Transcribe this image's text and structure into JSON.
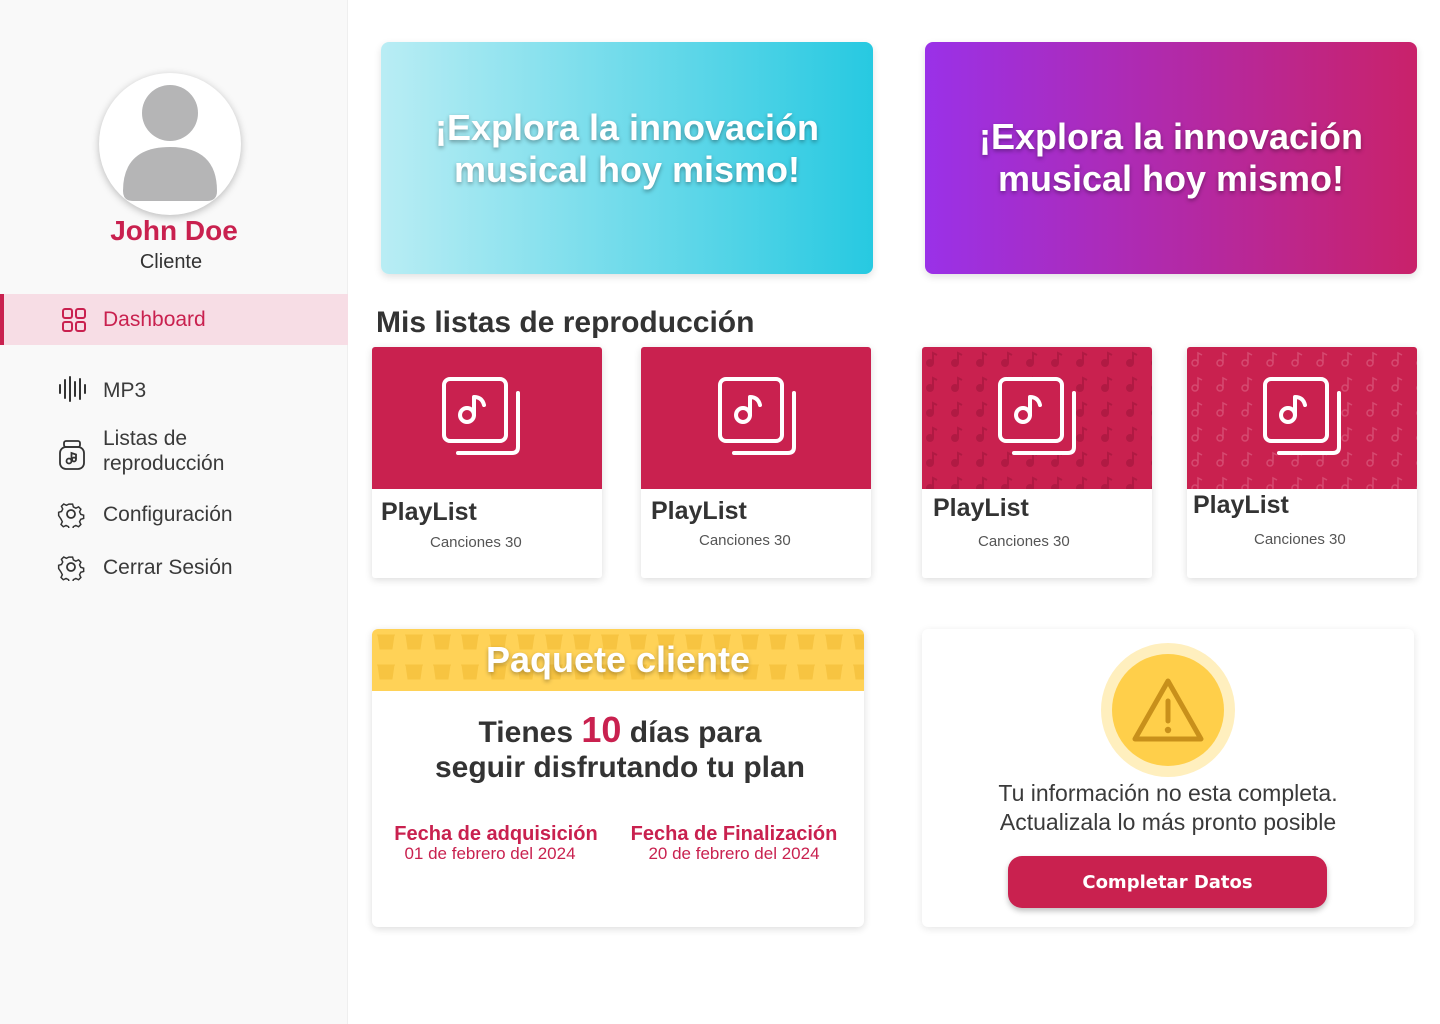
{
  "user": {
    "name": "John Doe",
    "role": "Cliente"
  },
  "sidebar": {
    "items": [
      {
        "label": "Dashboard",
        "icon": "grid-icon",
        "active": true
      },
      {
        "label": "MP3",
        "icon": "audio-wave-icon"
      },
      {
        "label": "Listas de reproducción",
        "icon": "music-jar-icon"
      },
      {
        "label": "Configuración",
        "icon": "gear-icon"
      },
      {
        "label": "Cerrar Sesión",
        "icon": "gear-icon"
      }
    ]
  },
  "banners": [
    {
      "text_line1": "¡Explora la innovación",
      "text_line2": "musical hoy mismo!"
    },
    {
      "text_line1": "¡Explora la innovación",
      "text_line2": "musical hoy mismo!"
    }
  ],
  "playlists_section": {
    "title": "Mis listas de reproducción",
    "items": [
      {
        "title": "PlayList",
        "count": "Canciones 30"
      },
      {
        "title": "PlayList",
        "count": "Canciones 30"
      },
      {
        "title": "PlayList",
        "count": "Canciones 30"
      },
      {
        "title": "PlayList",
        "count": "Canciones 30"
      }
    ]
  },
  "package": {
    "title": "Paquete cliente",
    "line1_before": "Tienes ",
    "days": "10",
    "line1_after": " días para",
    "line2": "seguir disfrutando tu plan",
    "acquisition_label": "Fecha de adquisición",
    "acquisition_date": "01 de febrero del 2024",
    "end_label": "Fecha de Finalización",
    "end_date": "20 de febrero del 2024"
  },
  "warning": {
    "line1": "Tu información no esta completa.",
    "line2": "Actualizala lo más pronto posible",
    "button": "Completar Datos"
  },
  "colors": {
    "accent": "#c9214f",
    "active_bg": "#f7dde5",
    "package_header": "#ffd257",
    "banner1_start": "#b9edf4",
    "banner1_end": "#27c9e1",
    "banner2_start": "#9a31e8",
    "banner2_end": "#c9226a"
  }
}
